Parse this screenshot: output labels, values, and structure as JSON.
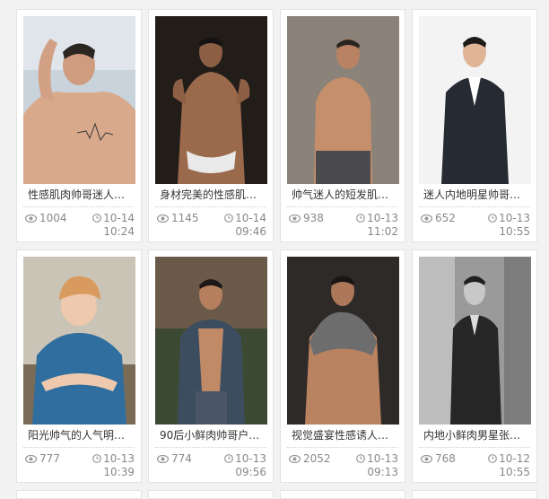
{
  "cards": [
    {
      "title": "性感肌肉帅哥迷人浴...",
      "views": "1004",
      "date": "10-14",
      "time": "10:24"
    },
    {
      "title": "身材完美的性感肌肉...",
      "views": "1145",
      "date": "10-14",
      "time": "09:46"
    },
    {
      "title": "帅气迷人的短发肌肉...",
      "views": "938",
      "date": "10-13",
      "time": "11:02"
    },
    {
      "title": "迷人内地明星帅哥刘...",
      "views": "652",
      "date": "10-13",
      "time": "10:55"
    },
    {
      "title": "阳光帅气的人气明星...",
      "views": "777",
      "date": "10-13",
      "time": "10:39"
    },
    {
      "title": "90后小鲜肉帅哥户外...",
      "views": "774",
      "date": "10-13",
      "time": "09:56"
    },
    {
      "title": "视觉盛宴性感诱人肌...",
      "views": "2052",
      "date": "10-13",
      "time": "09:13"
    },
    {
      "title": "内地小鲜肉男星张艺...",
      "views": "768",
      "date": "10-12",
      "time": "10:55"
    }
  ],
  "icons": {
    "views": "eye-icon",
    "time": "clock-icon"
  },
  "colors": {
    "meta_text": "#888888",
    "title_text": "#333333",
    "page_bg": "#f2f2f2"
  }
}
